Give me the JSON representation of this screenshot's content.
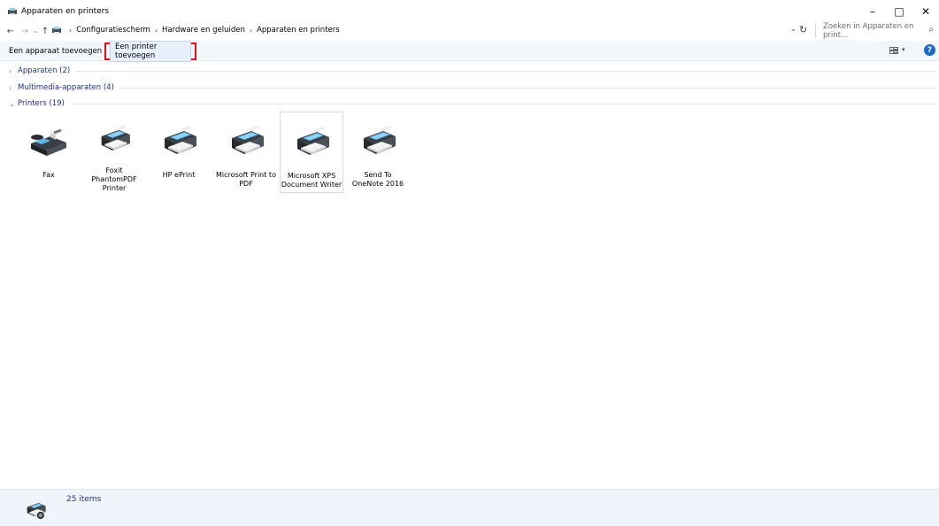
{
  "window": {
    "title": "Apparaten en printers",
    "controls": {
      "minimize": "–",
      "maximize": "□",
      "close": "✕"
    }
  },
  "address": {
    "breadcrumbs": [
      "Configuratiescherm",
      "Hardware en geluiden",
      "Apparaten en printers"
    ],
    "search_placeholder": "Zoeken in Apparaten en print..."
  },
  "toolbar": {
    "add_device": "Een apparaat toevoegen",
    "add_printer": "Een printer toevoegen",
    "highlight_color": "#e0141b"
  },
  "groups": [
    {
      "label": "Apparaten (2)",
      "expanded": false
    },
    {
      "label": "Multimedia-apparaten (4)",
      "expanded": false
    },
    {
      "label": "Printers (19)",
      "expanded": true
    }
  ],
  "printers": [
    {
      "label": "Fax",
      "icon": "fax-icon"
    },
    {
      "label": "Foxit PhantomPDF Printer",
      "icon": "printer-icon"
    },
    {
      "label": "HP ePrint",
      "icon": "printer-icon"
    },
    {
      "label": "Microsoft Print to PDF",
      "icon": "printer-icon"
    },
    {
      "label": "Microsoft XPS Document Writer",
      "icon": "printer-icon",
      "selected": true
    },
    {
      "label": "Send To OneNote 2016",
      "icon": "printer-icon"
    }
  ],
  "status": {
    "count_text": "25 items"
  }
}
